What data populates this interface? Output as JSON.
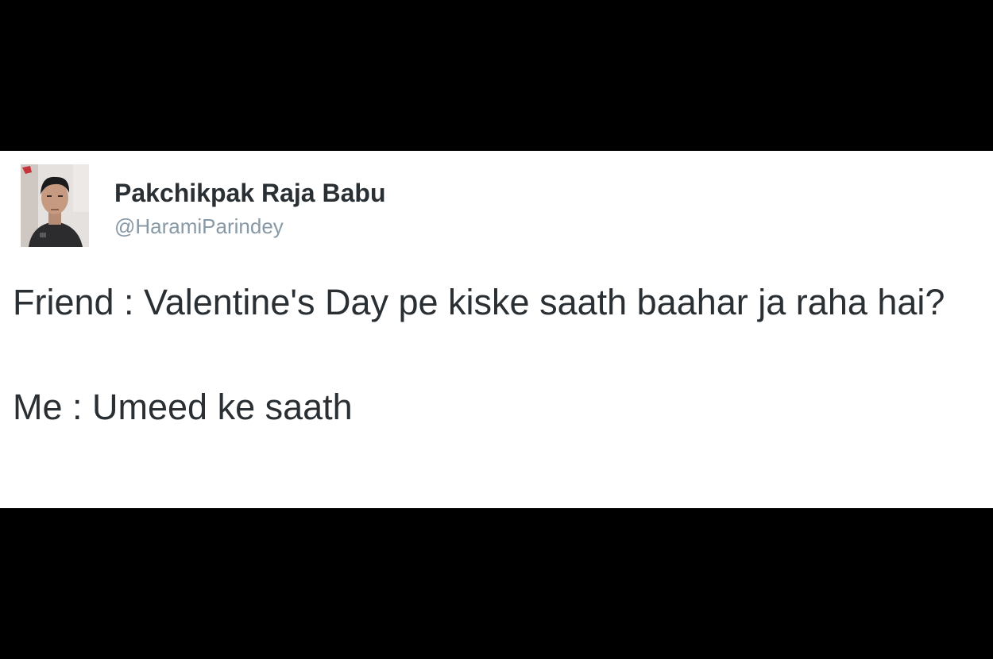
{
  "tweet": {
    "author": {
      "display_name": "Pakchikpak Raja Babu",
      "handle": "@HaramiParindey",
      "avatar_icon": "profile-photo"
    },
    "lines": [
      "Friend : Valentine's Day pe kiske saath baahar ja raha hai?",
      "Me : Umeed ke saath"
    ]
  },
  "colors": {
    "background": "#000000",
    "card": "#ffffff",
    "text": "#292f33",
    "handle": "#8899a6"
  }
}
